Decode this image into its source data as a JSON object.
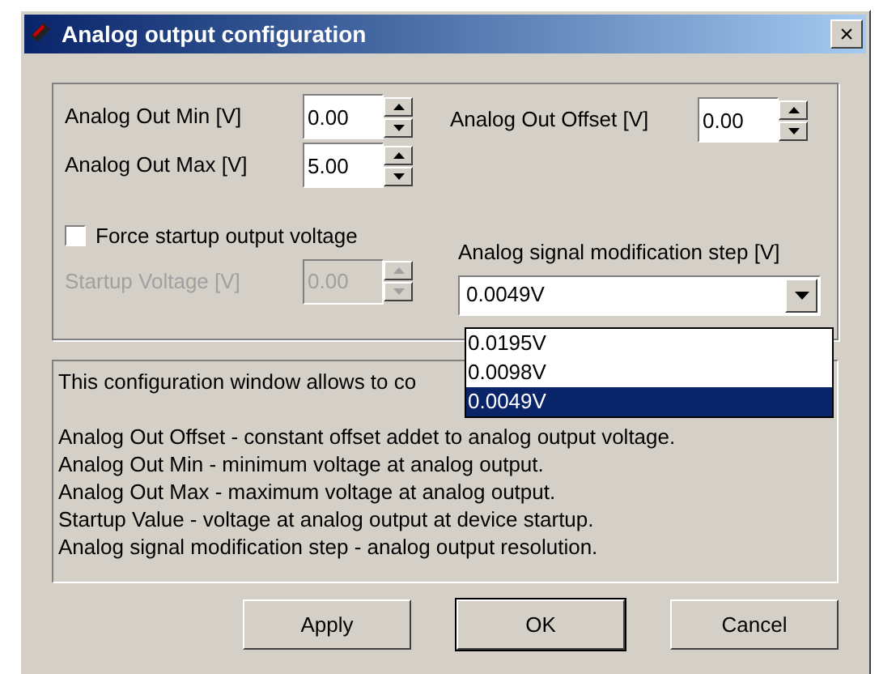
{
  "window": {
    "title": "Analog output configuration",
    "close": "×"
  },
  "fields": [
    {
      "label": "Analog Out Min [V]",
      "value": "0.00",
      "disabled": false
    },
    {
      "label": "Analog Out Max [V]",
      "value": "5.00",
      "disabled": false
    },
    {
      "label": "Analog Out Offset [V]",
      "value": "0.00",
      "disabled": false
    }
  ],
  "force_startup": {
    "label": "Force startup output voltage",
    "checked": false
  },
  "startup_voltage": {
    "label": "Startup Voltage [V]",
    "value": "0.00",
    "disabled": true
  },
  "step": {
    "label": "Analog signal modification step [V]",
    "value": "0.0049V",
    "expanded": true,
    "options": [
      {
        "label": "0.0195V",
        "selected": false
      },
      {
        "label": "0.0098V",
        "selected": false
      },
      {
        "label": "0.0049V",
        "selected": true
      }
    ]
  },
  "info": [
    "This configuration window allows to co",
    "Analog Out Offset - constant offset addet to analog output voltage.",
    "Analog Out Min - minimum voltage at analog output.",
    "Analog Out Max - maximum voltage at analog output.",
    "Startup Value - voltage at analog output at device startup.",
    "Analog signal modification step - analog output resolution."
  ],
  "buttons": [
    {
      "label": "Apply",
      "default": false
    },
    {
      "label": "OK",
      "default": true
    },
    {
      "label": "Cancel",
      "default": false
    }
  ]
}
